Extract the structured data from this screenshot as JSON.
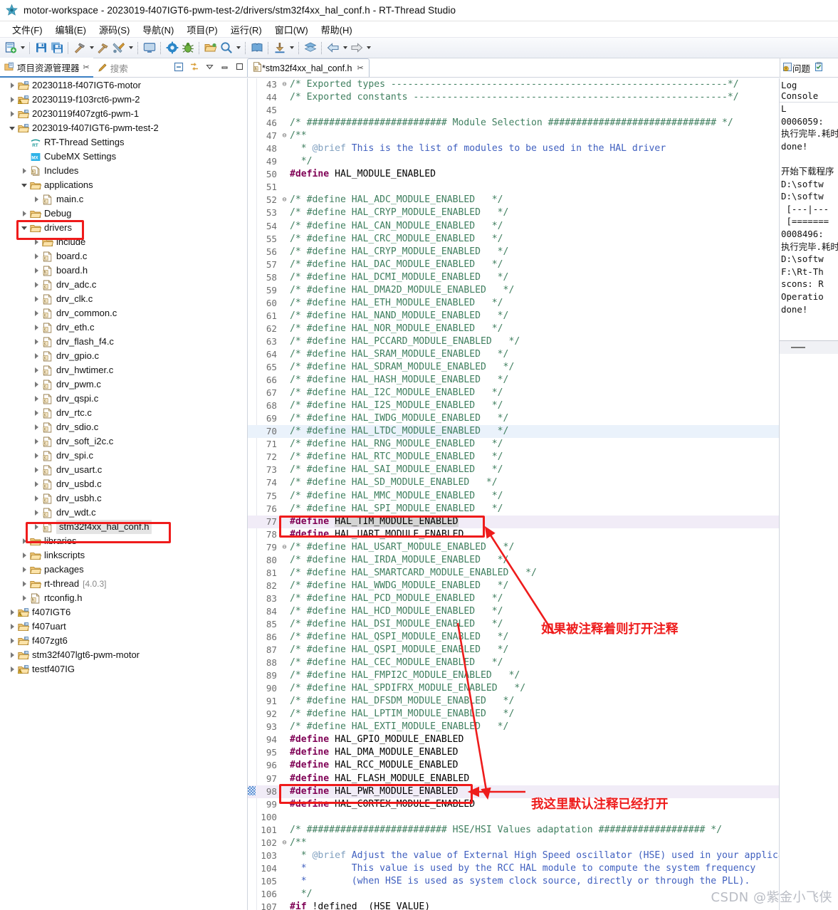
{
  "window": {
    "title": "motor-workspace - 2023019-f407IGT6-pwm-test-2/drivers/stm32f4xx_hal_conf.h - RT-Thread Studio",
    "logo_icon": "rt-thread-logo-icon"
  },
  "menubar": {
    "items": [
      {
        "label": "文件(F)",
        "name": "menu-file"
      },
      {
        "label": "编辑(E)",
        "name": "menu-edit"
      },
      {
        "label": "源码(S)",
        "name": "menu-source"
      },
      {
        "label": "导航(N)",
        "name": "menu-navigate"
      },
      {
        "label": "项目(P)",
        "name": "menu-project"
      },
      {
        "label": "运行(R)",
        "name": "menu-run"
      },
      {
        "label": "窗口(W)",
        "name": "menu-window"
      },
      {
        "label": "帮助(H)",
        "name": "menu-help"
      }
    ]
  },
  "toolbar": {
    "items": [
      {
        "name": "new-button",
        "icon": "new-file-icon",
        "arrow": true
      },
      {
        "sep": "solid"
      },
      {
        "name": "save-button",
        "icon": "save-icon"
      },
      {
        "name": "save-all-button",
        "icon": "save-all-icon"
      },
      {
        "sep": "solid"
      },
      {
        "name": "build-button",
        "icon": "hammer-icon",
        "arrow": true
      },
      {
        "name": "clean-button",
        "icon": "hammer-clean-icon"
      },
      {
        "name": "build-config-button",
        "icon": "tools-icon",
        "arrow": true
      },
      {
        "sep": "dotted"
      },
      {
        "name": "terminal-button",
        "icon": "monitor-icon"
      },
      {
        "name": "settings-button",
        "icon": "gear-icon"
      },
      {
        "name": "debug-button",
        "icon": "bug-icon"
      },
      {
        "name": "open-resource-button",
        "icon": "folder-open-icon"
      },
      {
        "name": "search-button",
        "icon": "magnifier-icon",
        "arrow": true
      },
      {
        "sep": "dotted"
      },
      {
        "name": "docs-button",
        "icon": "book-icon"
      },
      {
        "sep": "dotted"
      },
      {
        "name": "download-button",
        "icon": "download-icon",
        "arrow": true
      },
      {
        "sep": "dotted"
      },
      {
        "name": "layers-button",
        "icon": "layers-icon"
      },
      {
        "sep": "dotted"
      },
      {
        "name": "back-button",
        "icon": "arrow-left-icon",
        "arrow": true
      },
      {
        "name": "forward-button",
        "icon": "arrow-right-icon",
        "arrow": true
      }
    ]
  },
  "left_view_tabs": {
    "project_explorer": {
      "label": "项目资源管理器",
      "icon": "project-explorer-icon",
      "close": "✂"
    },
    "search": {
      "label": "搜索",
      "icon": "search-pen-icon"
    },
    "controls": {
      "collapse_all": "collapse-all-icon",
      "link_editor": "link-with-editor-icon",
      "view_menu": "view-menu-icon",
      "minimize": "minimize-icon",
      "maximize": "maximize-icon"
    }
  },
  "editor_tab": {
    "label": "*stm32f4xx_hal_conf.h",
    "icon": "h-file-icon",
    "close": "✂",
    "dirty": true
  },
  "right_tabs": {
    "problems": {
      "label": "问题",
      "icon": "problems-icon"
    },
    "tasks": {
      "icon": "tasks-icon"
    }
  },
  "explorer": {
    "tree": [
      {
        "indent": 0,
        "twist": "closed",
        "icon": "project-icon",
        "label": "20230118-f407IGT6-motor"
      },
      {
        "indent": 0,
        "twist": "closed",
        "icon": "project-warn-icon",
        "label": "20230119-f103rct6-pwm-2"
      },
      {
        "indent": 0,
        "twist": "closed",
        "icon": "project-icon",
        "label": "20230119f407zgt6-pwm-1"
      },
      {
        "indent": 0,
        "twist": "open",
        "icon": "project-icon",
        "label": "2023019-f407IGT6-pwm-test-2"
      },
      {
        "indent": 1,
        "twist": "none",
        "icon": "rt-settings-icon",
        "label": "RT-Thread Settings"
      },
      {
        "indent": 1,
        "twist": "none",
        "icon": "cubemx-icon",
        "label": "CubeMX Settings"
      },
      {
        "indent": 1,
        "twist": "closed",
        "icon": "includes-icon",
        "label": "Includes"
      },
      {
        "indent": 1,
        "twist": "open",
        "icon": "folder-icon",
        "label": "applications"
      },
      {
        "indent": 2,
        "twist": "closed",
        "icon": "c-file-icon",
        "label": "main.c"
      },
      {
        "indent": 1,
        "twist": "closed",
        "icon": "folder-icon",
        "label": "Debug"
      },
      {
        "indent": 1,
        "twist": "open",
        "icon": "folder-icon",
        "label": "drivers",
        "highlight": "red-box"
      },
      {
        "indent": 2,
        "twist": "closed",
        "icon": "folder-icon",
        "label": "include"
      },
      {
        "indent": 2,
        "twist": "closed",
        "icon": "c-file-icon",
        "label": "board.c"
      },
      {
        "indent": 2,
        "twist": "closed",
        "icon": "h-file-icon",
        "label": "board.h"
      },
      {
        "indent": 2,
        "twist": "closed",
        "icon": "c-file-icon",
        "label": "drv_adc.c"
      },
      {
        "indent": 2,
        "twist": "closed",
        "icon": "c-file-icon",
        "label": "drv_clk.c"
      },
      {
        "indent": 2,
        "twist": "closed",
        "icon": "c-file-icon",
        "label": "drv_common.c"
      },
      {
        "indent": 2,
        "twist": "closed",
        "icon": "c-file-icon",
        "label": "drv_eth.c"
      },
      {
        "indent": 2,
        "twist": "closed",
        "icon": "c-file-icon",
        "label": "drv_flash_f4.c"
      },
      {
        "indent": 2,
        "twist": "closed",
        "icon": "c-file-icon",
        "label": "drv_gpio.c"
      },
      {
        "indent": 2,
        "twist": "closed",
        "icon": "c-file-icon",
        "label": "drv_hwtimer.c"
      },
      {
        "indent": 2,
        "twist": "closed",
        "icon": "c-file-icon",
        "label": "drv_pwm.c"
      },
      {
        "indent": 2,
        "twist": "closed",
        "icon": "c-file-icon",
        "label": "drv_qspi.c"
      },
      {
        "indent": 2,
        "twist": "closed",
        "icon": "c-file-icon",
        "label": "drv_rtc.c"
      },
      {
        "indent": 2,
        "twist": "closed",
        "icon": "c-file-icon",
        "label": "drv_sdio.c"
      },
      {
        "indent": 2,
        "twist": "closed",
        "icon": "c-file-icon",
        "label": "drv_soft_i2c.c"
      },
      {
        "indent": 2,
        "twist": "closed",
        "icon": "c-file-icon",
        "label": "drv_spi.c"
      },
      {
        "indent": 2,
        "twist": "closed",
        "icon": "c-file-icon",
        "label": "drv_usart.c"
      },
      {
        "indent": 2,
        "twist": "closed",
        "icon": "c-file-icon",
        "label": "drv_usbd.c"
      },
      {
        "indent": 2,
        "twist": "closed",
        "icon": "c-file-icon",
        "label": "drv_usbh.c"
      },
      {
        "indent": 2,
        "twist": "closed",
        "icon": "c-file-icon",
        "label": "drv_wdt.c"
      },
      {
        "indent": 2,
        "twist": "closed",
        "icon": "h-file-icon",
        "label": "stm32f4xx_hal_conf.h",
        "selected": true,
        "highlight": "red-box"
      },
      {
        "indent": 1,
        "twist": "closed",
        "icon": "folder-icon",
        "label": "libraries"
      },
      {
        "indent": 1,
        "twist": "closed",
        "icon": "folder-icon",
        "label": "linkscripts"
      },
      {
        "indent": 1,
        "twist": "closed",
        "icon": "folder-icon",
        "label": "packages"
      },
      {
        "indent": 1,
        "twist": "closed",
        "icon": "folder-icon",
        "label": "rt-thread",
        "version": "[4.0.3]"
      },
      {
        "indent": 1,
        "twist": "closed",
        "icon": "h-file-icon",
        "label": "rtconfig.h"
      },
      {
        "indent": 0,
        "twist": "closed",
        "icon": "project-warn-icon",
        "label": "f407IGT6"
      },
      {
        "indent": 0,
        "twist": "closed",
        "icon": "project-icon",
        "label": "f407uart"
      },
      {
        "indent": 0,
        "twist": "closed",
        "icon": "project-icon",
        "label": "f407zgt6"
      },
      {
        "indent": 0,
        "twist": "closed",
        "icon": "project-icon",
        "label": "stm32f407lgt6-pwm-motor"
      },
      {
        "indent": 0,
        "twist": "closed",
        "icon": "project-warn-icon",
        "label": "testf407IG"
      }
    ]
  },
  "editor": {
    "first_line": 43,
    "current_line": 70,
    "lines": [
      {
        "n": 43,
        "fold": "⊖",
        "text": "/* Exported types ------------------------------------------------------------*/",
        "style": "cmt"
      },
      {
        "n": 44,
        "fold": "",
        "text": "/* Exported constants --------------------------------------------------------*/",
        "style": "cmt"
      },
      {
        "n": 45,
        "fold": "",
        "text": "",
        "style": "cmt"
      },
      {
        "n": 46,
        "fold": "",
        "text": "/* ######################### Module Selection ############################## */",
        "style": "cmt"
      },
      {
        "n": 47,
        "fold": "⊖",
        "text": "/**",
        "style": "cmt"
      },
      {
        "n": 48,
        "fold": "",
        "text": "  * @brief This is the list of modules to be used in the HAL driver",
        "style": "doc"
      },
      {
        "n": 49,
        "fold": "",
        "text": "  */",
        "style": "cmt"
      },
      {
        "n": 50,
        "fold": "",
        "text": "#define HAL_MODULE_ENABLED",
        "style": "def"
      },
      {
        "n": 51,
        "fold": "",
        "text": "",
        "style": "cmt"
      },
      {
        "n": 52,
        "fold": "⊖",
        "text": "/* #define HAL_ADC_MODULE_ENABLED   */",
        "style": "cmt"
      },
      {
        "n": 53,
        "fold": "",
        "text": "/* #define HAL_CRYP_MODULE_ENABLED   */",
        "style": "cmt"
      },
      {
        "n": 54,
        "fold": "",
        "text": "/* #define HAL_CAN_MODULE_ENABLED   */",
        "style": "cmt"
      },
      {
        "n": 55,
        "fold": "",
        "text": "/* #define HAL_CRC_MODULE_ENABLED   */",
        "style": "cmt"
      },
      {
        "n": 56,
        "fold": "",
        "text": "/* #define HAL_CRYP_MODULE_ENABLED   */",
        "style": "cmt"
      },
      {
        "n": 57,
        "fold": "",
        "text": "/* #define HAL_DAC_MODULE_ENABLED   */",
        "style": "cmt"
      },
      {
        "n": 58,
        "fold": "",
        "text": "/* #define HAL_DCMI_MODULE_ENABLED   */",
        "style": "cmt"
      },
      {
        "n": 59,
        "fold": "",
        "text": "/* #define HAL_DMA2D_MODULE_ENABLED   */",
        "style": "cmt"
      },
      {
        "n": 60,
        "fold": "",
        "text": "/* #define HAL_ETH_MODULE_ENABLED   */",
        "style": "cmt"
      },
      {
        "n": 61,
        "fold": "",
        "text": "/* #define HAL_NAND_MODULE_ENABLED   */",
        "style": "cmt"
      },
      {
        "n": 62,
        "fold": "",
        "text": "/* #define HAL_NOR_MODULE_ENABLED   */",
        "style": "cmt"
      },
      {
        "n": 63,
        "fold": "",
        "text": "/* #define HAL_PCCARD_MODULE_ENABLED   */",
        "style": "cmt"
      },
      {
        "n": 64,
        "fold": "",
        "text": "/* #define HAL_SRAM_MODULE_ENABLED   */",
        "style": "cmt"
      },
      {
        "n": 65,
        "fold": "",
        "text": "/* #define HAL_SDRAM_MODULE_ENABLED   */",
        "style": "cmt"
      },
      {
        "n": 66,
        "fold": "",
        "text": "/* #define HAL_HASH_MODULE_ENABLED   */",
        "style": "cmt"
      },
      {
        "n": 67,
        "fold": "",
        "text": "/* #define HAL_I2C_MODULE_ENABLED   */",
        "style": "cmt"
      },
      {
        "n": 68,
        "fold": "",
        "text": "/* #define HAL_I2S_MODULE_ENABLED   */",
        "style": "cmt"
      },
      {
        "n": 69,
        "fold": "",
        "text": "/* #define HAL_IWDG_MODULE_ENABLED   */",
        "style": "cmt"
      },
      {
        "n": 70,
        "fold": "",
        "text": "/* #define HAL_LTDC_MODULE_ENABLED   */",
        "style": "cmt",
        "current": true
      },
      {
        "n": 71,
        "fold": "",
        "text": "/* #define HAL_RNG_MODULE_ENABLED   */",
        "style": "cmt"
      },
      {
        "n": 72,
        "fold": "",
        "text": "/* #define HAL_RTC_MODULE_ENABLED   */",
        "style": "cmt"
      },
      {
        "n": 73,
        "fold": "",
        "text": "/* #define HAL_SAI_MODULE_ENABLED   */",
        "style": "cmt"
      },
      {
        "n": 74,
        "fold": "",
        "text": "/* #define HAL_SD_MODULE_ENABLED   */",
        "style": "cmt"
      },
      {
        "n": 75,
        "fold": "",
        "text": "/* #define HAL_MMC_MODULE_ENABLED   */",
        "style": "cmt"
      },
      {
        "n": 76,
        "fold": "",
        "text": "/* #define HAL_SPI_MODULE_ENABLED   */",
        "style": "cmt"
      },
      {
        "n": 77,
        "fold": "",
        "text": "#define HAL_TIM_MODULE_ENABLED",
        "style": "def",
        "selected_token": "HAL_TIM_MODULE_ENABLED",
        "marked": true
      },
      {
        "n": 78,
        "fold": "",
        "text": "#define HAL_UART_MODULE_ENABLED",
        "style": "def"
      },
      {
        "n": 79,
        "fold": "⊖",
        "text": "/* #define HAL_USART_MODULE_ENABLED   */",
        "style": "cmt"
      },
      {
        "n": 80,
        "fold": "",
        "text": "/* #define HAL_IRDA_MODULE_ENABLED   */",
        "style": "cmt"
      },
      {
        "n": 81,
        "fold": "",
        "text": "/* #define HAL_SMARTCARD_MODULE_ENABLED   */",
        "style": "cmt"
      },
      {
        "n": 82,
        "fold": "",
        "text": "/* #define HAL_WWDG_MODULE_ENABLED   */",
        "style": "cmt"
      },
      {
        "n": 83,
        "fold": "",
        "text": "/* #define HAL_PCD_MODULE_ENABLED   */",
        "style": "cmt"
      },
      {
        "n": 84,
        "fold": "",
        "text": "/* #define HAL_HCD_MODULE_ENABLED   */",
        "style": "cmt"
      },
      {
        "n": 85,
        "fold": "",
        "text": "/* #define HAL_DSI_MODULE_ENABLED   */",
        "style": "cmt"
      },
      {
        "n": 86,
        "fold": "",
        "text": "/* #define HAL_QSPI_MODULE_ENABLED   */",
        "style": "cmt"
      },
      {
        "n": 87,
        "fold": "",
        "text": "/* #define HAL_QSPI_MODULE_ENABLED   */",
        "style": "cmt"
      },
      {
        "n": 88,
        "fold": "",
        "text": "/* #define HAL_CEC_MODULE_ENABLED   */",
        "style": "cmt"
      },
      {
        "n": 89,
        "fold": "",
        "text": "/* #define HAL_FMPI2C_MODULE_ENABLED   */",
        "style": "cmt"
      },
      {
        "n": 90,
        "fold": "",
        "text": "/* #define HAL_SPDIFRX_MODULE_ENABLED   */",
        "style": "cmt"
      },
      {
        "n": 91,
        "fold": "",
        "text": "/* #define HAL_DFSDM_MODULE_ENABLED   */",
        "style": "cmt"
      },
      {
        "n": 92,
        "fold": "",
        "text": "/* #define HAL_LPTIM_MODULE_ENABLED   */",
        "style": "cmt"
      },
      {
        "n": 93,
        "fold": "",
        "text": "/* #define HAL_EXTI_MODULE_ENABLED   */",
        "style": "cmt"
      },
      {
        "n": 94,
        "fold": "",
        "text": "#define HAL_GPIO_MODULE_ENABLED",
        "style": "def"
      },
      {
        "n": 95,
        "fold": "",
        "text": "#define HAL_DMA_MODULE_ENABLED",
        "style": "def"
      },
      {
        "n": 96,
        "fold": "",
        "text": "#define HAL_RCC_MODULE_ENABLED",
        "style": "def"
      },
      {
        "n": 97,
        "fold": "",
        "text": "#define HAL_FLASH_MODULE_ENABLED",
        "style": "def"
      },
      {
        "n": 98,
        "fold": "",
        "text": "#define HAL_PWR_MODULE_ENABLED",
        "style": "def",
        "marked": true,
        "gutter_marker": "changed-marker"
      },
      {
        "n": 99,
        "fold": "",
        "text": "#define HAL_CORTEX_MODULE_ENABLED",
        "style": "def"
      },
      {
        "n": 100,
        "fold": "",
        "text": "",
        "style": "cmt"
      },
      {
        "n": 101,
        "fold": "",
        "text": "/* ######################### HSE/HSI Values adaptation ################### */",
        "style": "cmt"
      },
      {
        "n": 102,
        "fold": "⊖",
        "text": "/**",
        "style": "cmt"
      },
      {
        "n": 103,
        "fold": "",
        "text": "  * @brief Adjust the value of External High Speed oscillator (HSE) used in your application.",
        "style": "doc"
      },
      {
        "n": 104,
        "fold": "",
        "text": "  *        This value is used by the RCC HAL module to compute the system frequency",
        "style": "doc"
      },
      {
        "n": 105,
        "fold": "",
        "text": "  *        (when HSE is used as system clock source, directly or through the PLL).",
        "style": "doc"
      },
      {
        "n": 106,
        "fold": "",
        "text": "  */",
        "style": "cmt"
      },
      {
        "n": 107,
        "fold": "",
        "text": "#if !defined  (HSE_VALUE)",
        "style": "def"
      }
    ]
  },
  "annotations": [
    {
      "name": "annotation-uncomment-note",
      "text": "如果被注释着则打开注释",
      "color": "#ee1c1c"
    },
    {
      "name": "annotation-already-open-note",
      "text": "我这里默认注释已经打开",
      "color": "#ee1c1c"
    }
  ],
  "log_panel": {
    "title": "Log Console",
    "lines": [
      "L",
      "0006059:",
      "执行完毕.耗时",
      "done!",
      "",
      "开始下载程序",
      "D:\\softw",
      "D:\\softw",
      " [---|---",
      " [=======",
      "0008496:",
      "执行完毕.耗时",
      "D:\\softw",
      "F:\\Rt-Th",
      "scons: R",
      "Operatio",
      "done!"
    ]
  },
  "watermark": {
    "text": "CSDN @紫金小飞侠"
  },
  "colors": {
    "red_annotation": "#ee1c1c",
    "comment_green": "#3f7f5f",
    "keyword_purple": "#7f0055",
    "doc_blue": "#3f5fbf",
    "current_line": "#eaf2fb",
    "selection_gray": "#d4d4d4"
  }
}
